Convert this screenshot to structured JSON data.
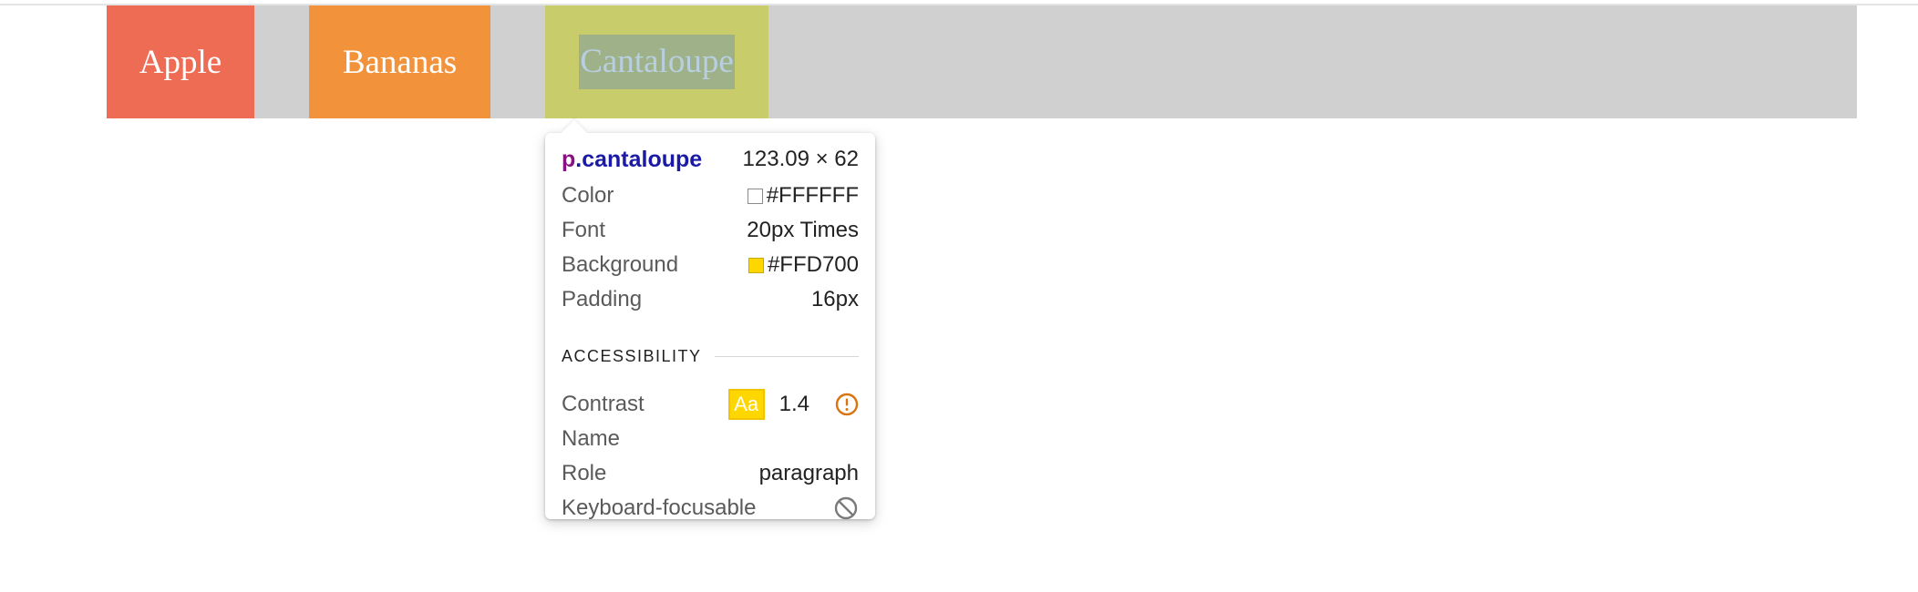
{
  "nav": {
    "items": [
      {
        "label": "Apple",
        "color": "#EE6C54"
      },
      {
        "label": "Bananas",
        "color": "#F2923A"
      },
      {
        "label": "Cantaloupe",
        "color": "#C8CC6A"
      }
    ]
  },
  "tooltip": {
    "selector_tag": "p",
    "selector_class": ".cantaloupe",
    "dimensions": "123.09 × 62",
    "rows": {
      "color": {
        "label": "Color",
        "value": "#FFFFFF",
        "swatch": "#FFFFFF"
      },
      "font": {
        "label": "Font",
        "value": "20px Times"
      },
      "background": {
        "label": "Background",
        "value": "#FFD700",
        "swatch": "#FFD700"
      },
      "padding": {
        "label": "Padding",
        "value": "16px"
      }
    },
    "accessibility": {
      "title": "ACCESSIBILITY",
      "contrast": {
        "label": "Contrast",
        "badge": "Aa",
        "ratio": "1.4",
        "icon": "warning-icon"
      },
      "name": {
        "label": "Name",
        "value": ""
      },
      "role": {
        "label": "Role",
        "value": "paragraph"
      },
      "keyboard": {
        "label": "Keyboard-focusable",
        "icon": "not-allowed-icon"
      }
    }
  }
}
